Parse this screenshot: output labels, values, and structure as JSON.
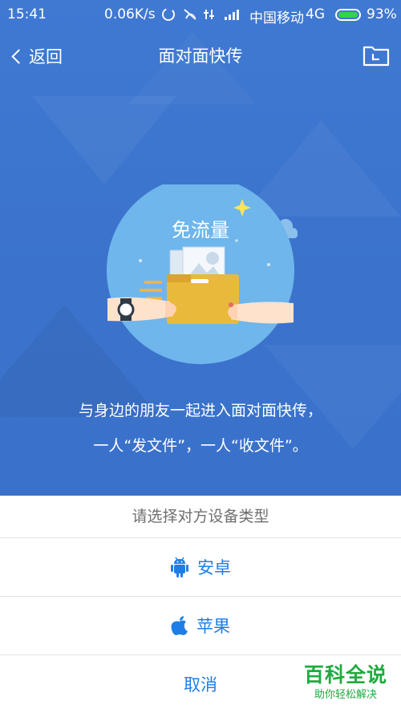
{
  "status_bar": {
    "time": "15:41",
    "speed": "0.06K/s",
    "carrier": "中国移动",
    "network": "4G",
    "battery": "93%",
    "battery_level": 0.93
  },
  "header": {
    "back_label": "返回",
    "title": "面对面快传"
  },
  "illustration": {
    "label": "免流量"
  },
  "description": {
    "line1": "与身边的朋友一起进入面对面快传，",
    "line2": "一人“发文件”，一人“收文件”。"
  },
  "sheet": {
    "title": "请选择对方设备类型",
    "options": [
      {
        "label": "安卓",
        "icon": "android-icon"
      },
      {
        "label": "苹果",
        "icon": "apple-icon"
      }
    ],
    "cancel": "取消"
  },
  "watermark": {
    "title": "百科全说",
    "subtitle": "助你轻松解决"
  },
  "colors": {
    "background_blue": "#3d77cf",
    "action_blue": "#1f7ee6",
    "battery_green": "#35d24a",
    "watermark_green": "#1faa3f"
  }
}
